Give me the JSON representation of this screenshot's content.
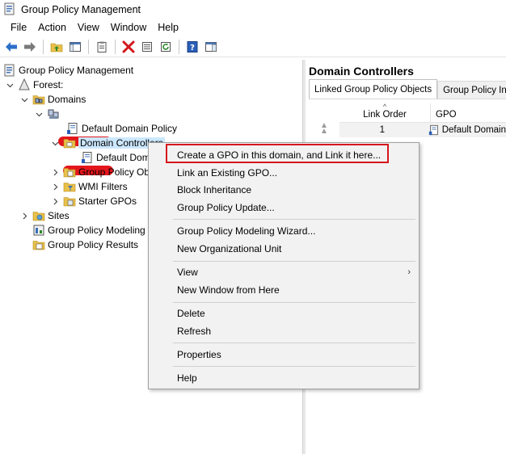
{
  "window": {
    "title": "Group Policy Management",
    "icon": "gpm-app-icon"
  },
  "menubar": {
    "items": [
      "File",
      "Action",
      "View",
      "Window",
      "Help"
    ]
  },
  "toolbar": {
    "buttons": [
      "back-arrow-icon",
      "forward-arrow-icon",
      "up-folder-icon",
      "show-hide-tree-icon",
      "clipboard-icon",
      "delete-x-icon",
      "properties-icon",
      "refresh-icon",
      "help-icon",
      "console-pane-icon"
    ]
  },
  "tree": {
    "root": "Group Policy Management",
    "forest": "Forest:",
    "domains": "Domains",
    "default_domain_policy": "Default Domain Policy",
    "domain_controllers": "Domain Controllers",
    "default_domain_controllers": "Default Dom",
    "group_policy_objects": "Group Policy Ob",
    "wmi_filters": "WMI Filters",
    "starter_gpos": "Starter GPOs",
    "sites": "Sites",
    "gp_modeling": "Group Policy Modeling",
    "gp_results": "Group Policy Results"
  },
  "right_pane": {
    "title": "Domain Controllers",
    "tabs": [
      "Linked Group Policy Objects",
      "Group Policy Inherit"
    ],
    "columns": [
      "Link Order",
      "GPO"
    ],
    "rows": [
      {
        "link_order": "1",
        "gpo": "Default Domain"
      }
    ]
  },
  "context_menu": {
    "items": [
      "Create a GPO in this domain, and Link it here...",
      "Link an Existing GPO...",
      "Block Inheritance",
      "Group Policy Update...",
      "Group Policy Modeling Wizard...",
      "New Organizational Unit",
      "View",
      "New Window from Here",
      "Delete",
      "Refresh",
      "Properties",
      "Help"
    ],
    "highlight_color": "#d6161c"
  },
  "colors": {
    "redaction": "#e4161c",
    "selection": "#cce8ff"
  }
}
